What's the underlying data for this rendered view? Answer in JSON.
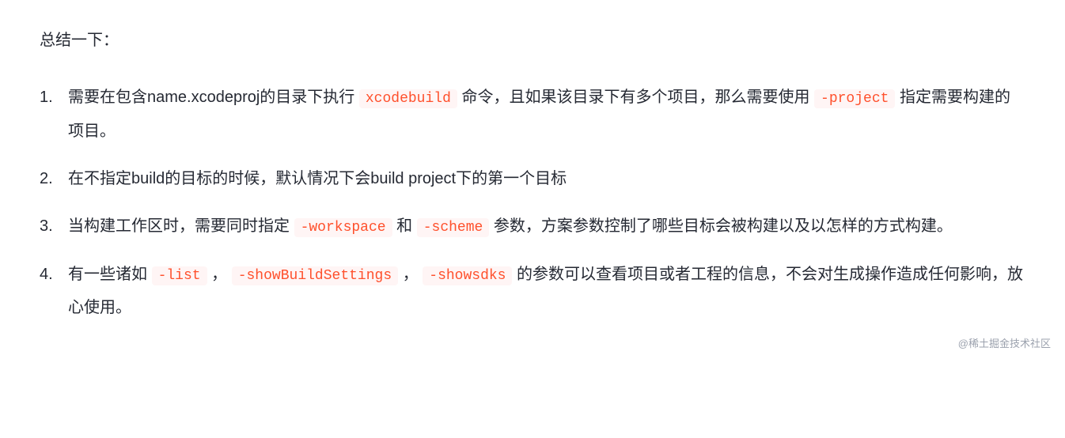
{
  "intro": "总结一下：",
  "items": [
    {
      "parts": [
        {
          "type": "text",
          "value": "需要在包含name.xcodeproj的目录下执行 "
        },
        {
          "type": "code",
          "value": "xcodebuild"
        },
        {
          "type": "text",
          "value": " 命令，且如果该目录下有多个项目，那么需要使用 "
        },
        {
          "type": "code",
          "value": "-project"
        },
        {
          "type": "text",
          "value": " 指定需要构建的项目。"
        }
      ]
    },
    {
      "parts": [
        {
          "type": "text",
          "value": "在不指定build的目标的时候，默认情况下会build project下的第一个目标"
        }
      ]
    },
    {
      "parts": [
        {
          "type": "text",
          "value": "当构建工作区时，需要同时指定 "
        },
        {
          "type": "code",
          "value": "-workspace"
        },
        {
          "type": "text",
          "value": " 和 "
        },
        {
          "type": "code",
          "value": "-scheme"
        },
        {
          "type": "text",
          "value": " 参数，方案参数控制了哪些目标会被构建以及以怎样的方式构建。"
        }
      ]
    },
    {
      "parts": [
        {
          "type": "text",
          "value": "有一些诸如 "
        },
        {
          "type": "code",
          "value": "-list"
        },
        {
          "type": "text",
          "value": " ， "
        },
        {
          "type": "code",
          "value": "-showBuildSettings"
        },
        {
          "type": "text",
          "value": " ， "
        },
        {
          "type": "code",
          "value": "-showsdks"
        },
        {
          "type": "text",
          "value": " 的参数可以查看项目或者工程的信息，不会对生成操作造成任何影响，放心使用。"
        }
      ]
    }
  ],
  "watermark": "@稀土掘金技术社区"
}
